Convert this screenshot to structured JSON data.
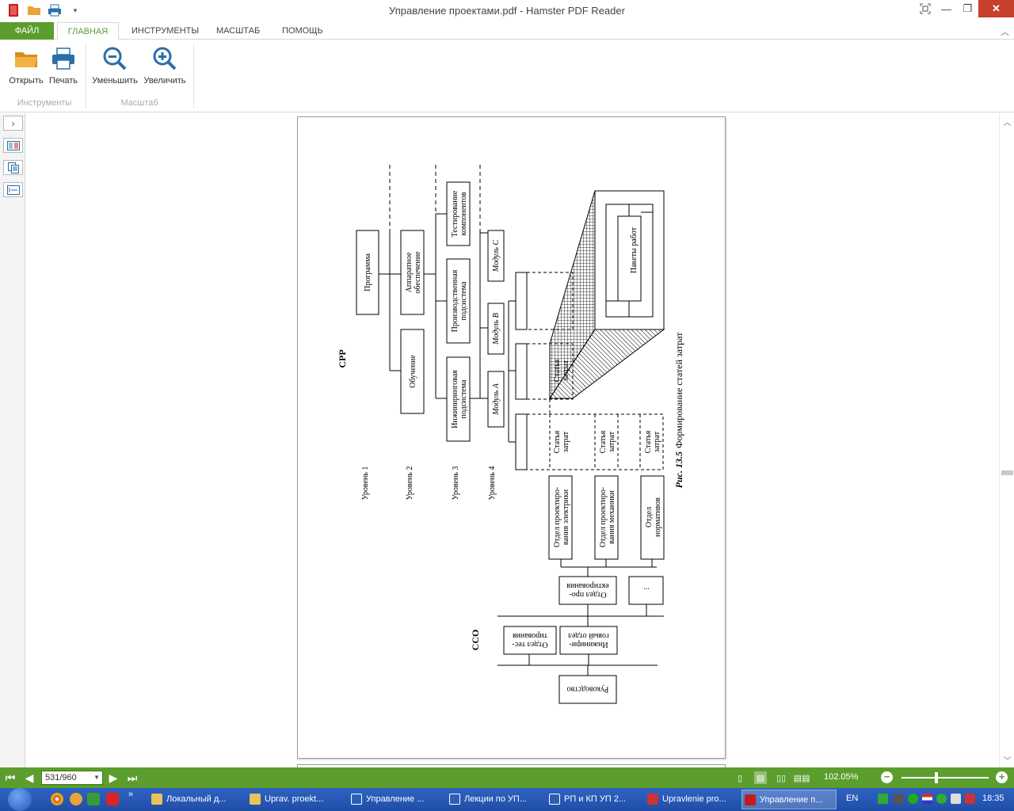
{
  "app": {
    "title": "Управление проектами.pdf - Hamster PDF Reader",
    "window_buttons": {
      "minimize": "—",
      "restore": "❐",
      "close": "✕"
    }
  },
  "ribbon": {
    "tabs": [
      "ФАЙЛ",
      "ГЛАВНАЯ",
      "ИНСТРУМЕНТЫ",
      "МАСШТАБ",
      "ПОМОЩЬ"
    ],
    "active_tab": "ГЛАВНАЯ",
    "buttons": {
      "open": "Открыть",
      "print": "Печать",
      "zoom_out": "Уменьшить",
      "zoom_in": "Увеличить"
    },
    "groups": {
      "tools": "Инструменты",
      "zoom": "Масштаб"
    }
  },
  "colors": {
    "accent": "#5b9e2d",
    "close": "#c7402c",
    "taskbar": "#2a5cba"
  },
  "figure": {
    "org_left": "ССО",
    "org_top": "СРР",
    "management": "Руководство",
    "testing_dept": "Отдел тес-тирования",
    "engineering_dept": "Инжинири-говый отдел",
    "design_dept": "Отдел про-ектирования",
    "ellipsis": "...",
    "dept_electric": "Отдел проектиро-вания электрики",
    "dept_mechanic": "Отдел проектиро-вания механики",
    "dept_norms": "Отдел нормативов",
    "cost_item": "Статья затрат",
    "level1": "Уровень 1",
    "level2": "Уровень 2",
    "level3": "Уровень 3",
    "level4": "Уровень 4",
    "program": "Программа",
    "hardware": "Аппаратное обеспечение",
    "training": "Обучение",
    "testing_components": "Тестирование компонентов",
    "production_subsystem": "Производственная подсистема",
    "engineering_subsystem": "Инжиниринговая подсистема",
    "module_a": "Модуль A",
    "module_b": "Модуль B",
    "module_c": "Модуль C",
    "work_packages": "Пакеты работ",
    "caption_bold": "Рис. 13.5",
    "caption": "Формирование статей затрат"
  },
  "statusbar": {
    "page_indicator": "531/960",
    "zoom": "102.05%"
  },
  "taskbar": {
    "tasks": [
      "Локальный д...",
      "Uprav. proekt...",
      "Управление ...",
      "Лекции по УП...",
      "РП и КП  УП 2...",
      "Upravlenie pro...",
      "Управление п..."
    ],
    "lang": "EN",
    "time": "18:35"
  }
}
